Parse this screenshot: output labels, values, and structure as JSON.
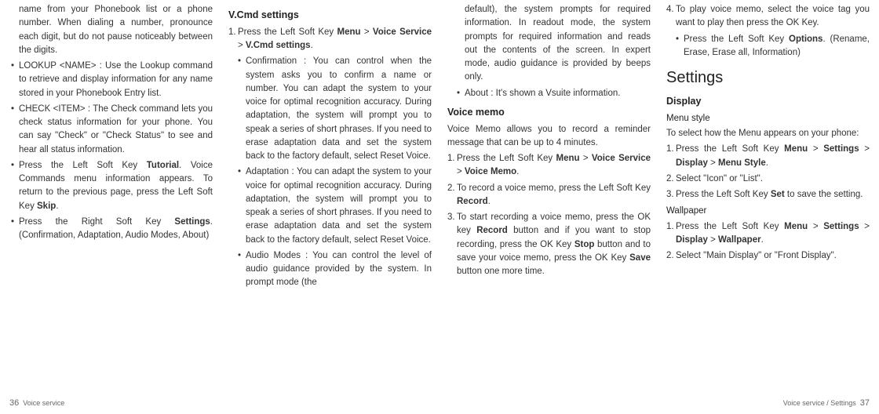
{
  "col1": {
    "p1": "name from your Phonebook list or a phone number. When dialing a number, pronounce each digit, but do not pause noticeably between the digits.",
    "p2a": "LOOKUP <NAME> : Use the Lookup command to retrieve and display information for any name stored in your Phonebook Entry list.",
    "p2b": "CHECK <ITEM> : The Check command lets you check status information for your phone. You can say \"Check\" or \"Check Status\" to see and hear all status information.",
    "p3a_pre": "Press the Left Soft Key ",
    "p3a_bold": "Tutorial",
    "p3a_post": ". Voice Commands menu information appears. To return to the previous page, press the Left Soft Key ",
    "p3a_bold2": "Skip",
    "p3a_post2": ".",
    "p4a_pre": "Press the Right Soft Key ",
    "p4a_bold": "Settings",
    "p4a_post": ". (Confirmation, Adaptation, Audio Modes, About)"
  },
  "col2": {
    "h": "V.Cmd settings",
    "n1_pre": "Press the Left Soft Key ",
    "n1_b1": "Menu",
    "n1_mid": " > ",
    "n1_b2": "Voice Service",
    "n1_mid2": " > ",
    "n1_b3": "V.Cmd settings",
    "n1_post": ".",
    "b1": "Confirmation : You can control when the system asks you to confirm a name or number. You can adapt the system to your voice for optimal recognition accuracy. During adaptation, the system will prompt you to speak a series of short phrases. If you need to erase adaptation data and set the system back to the factory default, select Reset Voice.",
    "b2": "Adaptation : You can adapt the system to your voice for optimal recognition accuracy. During adaptation, the system will prompt you to speak a series of short phrases. If you need to erase adaptation data and set the system back to the factory default, select Reset Voice.",
    "b3": "Audio Modes : You can control the level of audio guidance provided by the system. In prompt mode (the"
  },
  "col3": {
    "p1": "default), the system prompts for required information. In readout mode, the system prompts for required information and reads out the contents of the screen. In expert mode, audio guidance is provided by beeps only.",
    "b1": "About : It's shown a Vsuite information.",
    "h2": "Voice memo",
    "p2": "Voice Memo allows you to record a reminder message that can be up to 4 minutes.",
    "n1_pre": "Press the Left Soft Key ",
    "n1_b1": "Menu",
    "n1_mid": " > ",
    "n1_b2": "Voice Service",
    "n1_mid2": " > ",
    "n1_b3": "Voice Memo",
    "n1_post": ".",
    "n2_pre": "To record a voice memo, press the Left Soft Key ",
    "n2_b": "Record",
    "n2_post": ".",
    "n3_pre": "To start recording a voice memo, press the OK key ",
    "n3_b1": "Record",
    "n3_mid1": " button and if you want to stop recording, press the OK Key ",
    "n3_b2": "Stop",
    "n3_mid2": " button and to save your voice memo, press the OK Key ",
    "n3_b3": "Save",
    "n3_post": " button one more time."
  },
  "col4": {
    "n4_pre": "To play voice memo, select the voice tag you want to play then press the OK Key.",
    "b1_pre": "Press the Left Soft Key ",
    "b1_b": "Options",
    "b1_post": ". (Rename, Erase, Erase all, Information)",
    "h1": "Settings",
    "h2a": "Display",
    "h3a": "Menu style",
    "p1": "To select how the Menu appears on your phone:",
    "n1_pre": "Press the Left Soft Key ",
    "n1_b1": "Menu",
    "n1_mid": " > ",
    "n1_b2": "Settings",
    "n1_mid2": " > ",
    "n1_b3": "Display",
    "n1_mid3": " > ",
    "n1_b4": "Menu Style",
    "n1_post": ".",
    "n2": "Select \"Icon\" or \"List\".",
    "n3_pre": "Press the Left Soft Key ",
    "n3_b": "Set",
    "n3_post": " to save the setting.",
    "h3b": "Wallpaper",
    "w1_pre": "Press the Left Soft Key ",
    "w1_b1": "Menu",
    "w1_mid": " > ",
    "w1_b2": "Settings",
    "w1_mid2": " > ",
    "w1_b3": "Display",
    "w1_mid3": " > ",
    "w1_b4": "Wallpaper",
    "w1_post": ".",
    "w2": "Select \"Main Display\" or \"Front Display\"."
  },
  "footer": {
    "left_label": "Voice service",
    "left_num": "36",
    "right_label": "Voice service / Settings",
    "right_num": "37"
  }
}
